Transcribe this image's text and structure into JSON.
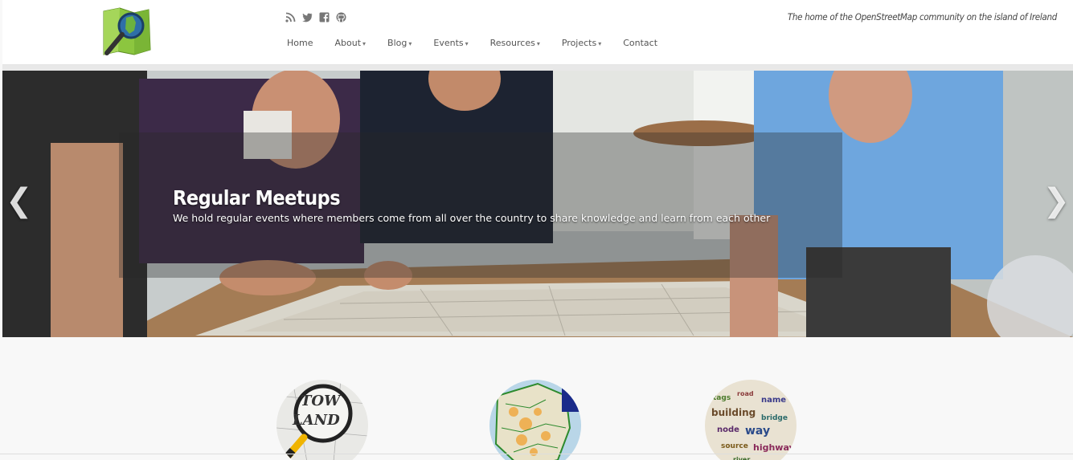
{
  "header": {
    "tagline": "The home of the OpenStreetMap community on the island of Ireland",
    "nav": [
      {
        "label": "Home",
        "dropdown": false
      },
      {
        "label": "About",
        "dropdown": true
      },
      {
        "label": "Blog",
        "dropdown": true
      },
      {
        "label": "Events",
        "dropdown": true
      },
      {
        "label": "Resources",
        "dropdown": true
      },
      {
        "label": "Projects",
        "dropdown": true
      },
      {
        "label": "Contact",
        "dropdown": false
      }
    ],
    "social_icons": [
      "rss-icon",
      "twitter-icon",
      "facebook-icon",
      "github-icon"
    ]
  },
  "carousel": {
    "title": "Regular Meetups",
    "text": "We hold regular events where members come from all over the country to share knowledge and learn from each other",
    "prev": "❮",
    "next": "❯"
  },
  "colors": {
    "header_bg": "#ffffff",
    "nav_text": "#555555",
    "page_bg": "#f8f8f8"
  }
}
